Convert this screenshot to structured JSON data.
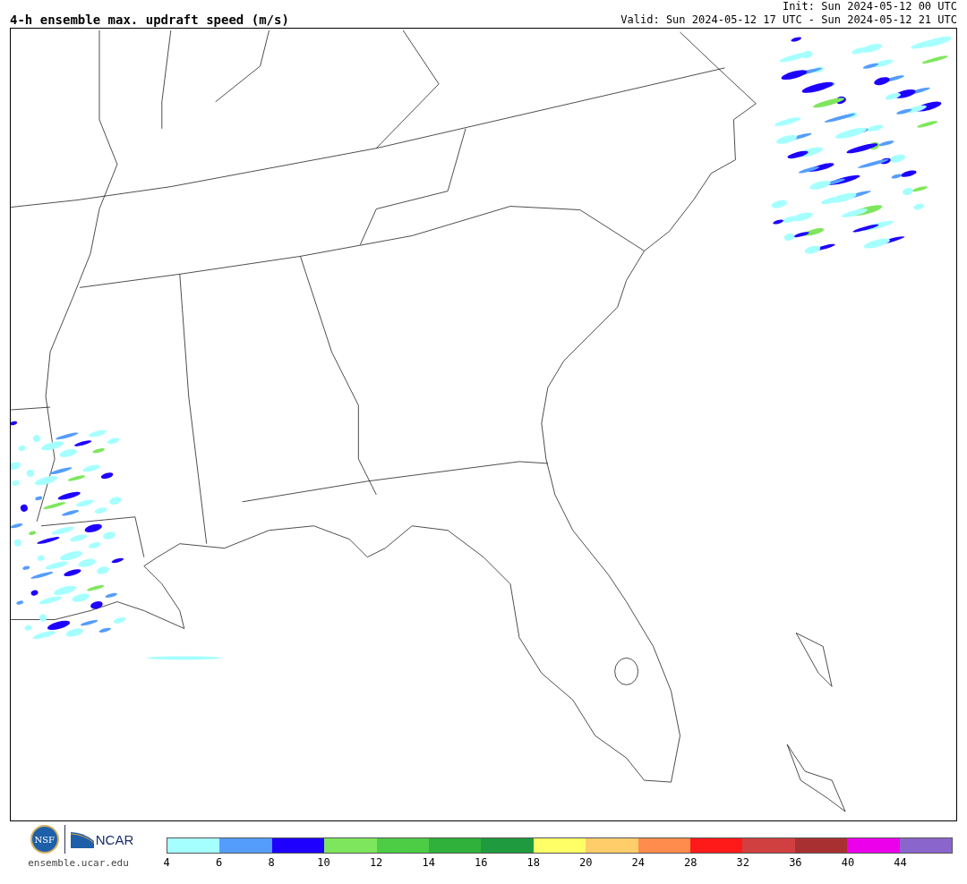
{
  "title": "4-h ensemble max. updraft speed (m/s)",
  "init": "Init: Sun 2024-05-12 00 UTC",
  "valid": "Valid: Sun 2024-05-12 17 UTC - Sun 2024-05-12 21 UTC",
  "logos": {
    "nsf": "NSF",
    "ncar": "NCAR",
    "url": "ensemble.ucar.edu"
  },
  "legend": {
    "bins": [
      {
        "label": "4",
        "color": "#a6ffff"
      },
      {
        "label": "6",
        "color": "#559dfc"
      },
      {
        "label": "8",
        "color": "#1e00ff"
      },
      {
        "label": "10",
        "color": "#7ee65c"
      },
      {
        "label": "12",
        "color": "#4dcc46"
      },
      {
        "label": "14",
        "color": "#2fb13c"
      },
      {
        "label": "16",
        "color": "#209a3f"
      },
      {
        "label": "18",
        "color": "#ffff66"
      },
      {
        "label": "20",
        "color": "#ffcd6a"
      },
      {
        "label": "24",
        "color": "#ff8c4c"
      },
      {
        "label": "28",
        "color": "#ff1a1a"
      },
      {
        "label": "32",
        "color": "#d04040"
      },
      {
        "label": "36",
        "color": "#a83030"
      },
      {
        "label": "40",
        "color": "#ec00ec"
      },
      {
        "label": "44",
        "color": "#8a66cc"
      }
    ]
  }
}
